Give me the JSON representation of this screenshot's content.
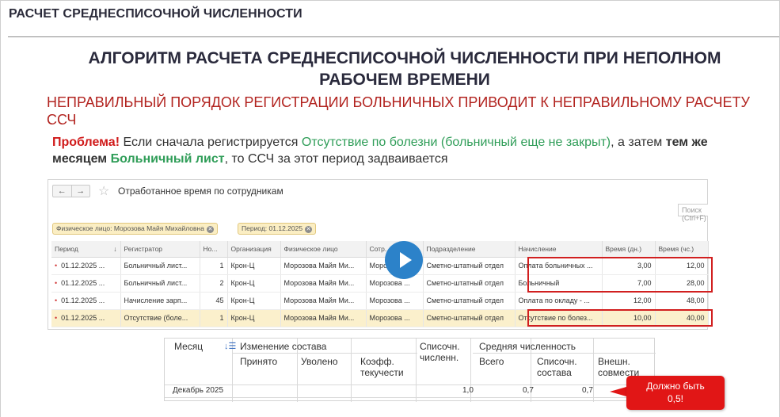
{
  "page": {
    "title": "РАСЧЕТ СРЕДНЕСПИСОЧНОЙ ЧИСЛЕННОСТИ"
  },
  "slide": {
    "heading_line1": "АЛГОРИТМ РАСЧЕТА СРЕДНЕСПИСОЧНОЙ ЧИСЛЕННОСТИ ПРИ НЕПОЛНОМ",
    "heading_line2": "РАБОЧЕМ ВРЕМЕНИ",
    "subtitle": "НЕПРАВИЛЬНЫЙ ПОРЯДОК РЕГИСТРАЦИИ БОЛЬНИЧНЫХ ПРИВОДИТ К НЕПРАВИЛЬНОМУ РАСЧЕТУ ССЧ",
    "problem": {
      "label": "Проблема!",
      "t1": " Если сначала регистрируется ",
      "g1": "Отсутствие по болезни (больничный еще не закрыт)",
      "t2": ", а затем ",
      "b1": "тем же месяцем",
      "t3": " ",
      "g2": "Больничный лист",
      "t4": ", то ССЧ за этот период задваивается"
    },
    "bottom_fragment": "— —— —— — —— — —— —"
  },
  "window": {
    "back": "←",
    "forward": "→",
    "star": "☆",
    "title": "Отработанное время по сотрудникам",
    "search_placeholder": "Поиск (Ctrl+F)",
    "chips": [
      {
        "text": "Физическое лицо: Морозова Майя Михайловна"
      },
      {
        "text": "Период: 01.12.2025"
      }
    ],
    "columns": [
      "Период",
      "Регистратор",
      "Но...",
      "Организация",
      "Физическое лицо",
      "Сотр...",
      "Подразделение",
      "Начисление",
      "Время (дн.)",
      "Время (чс.)"
    ],
    "sort_indicator": "↓",
    "rows": [
      [
        "01.12.2025 ...",
        "Больничный лист...",
        "1",
        "Крон-Ц",
        "Морозова Майя Ми...",
        "Морозова ...",
        "Сметно-штатный отдел",
        "Оплата больничных ...",
        "3,00",
        "12,00"
      ],
      [
        "01.12.2025 ...",
        "Больничный лист...",
        "2",
        "Крон-Ц",
        "Морозова Майя Ми...",
        "Морозова ...",
        "Сметно-штатный отдел",
        "Больничный",
        "7,00",
        "28,00"
      ],
      [
        "01.12.2025 ...",
        "Начисление зарп...",
        "45",
        "Крон-Ц",
        "Морозова Майя Ми...",
        "Морозова ...",
        "Сметно-штатный отдел",
        "Оплата по окладу - ...",
        "12,00",
        "48,00"
      ],
      [
        "01.12.2025 ...",
        "Отсутствие (боле...",
        "1",
        "Крон-Ц",
        "Морозова Майя Ми...",
        "Морозова ...",
        "Сметно-штатный отдел",
        "Отсутствие по болез...",
        "10,00",
        "40,00"
      ]
    ],
    "row_marker": "•"
  },
  "report": {
    "month": "Месяц",
    "sort_icon": "↓☰",
    "change": "Изменение состава",
    "hired": "Принято",
    "fired": "Уволено",
    "turnover1": "Коэфф.",
    "turnover2": "текучести",
    "listed1": "Списочн.",
    "listed2": "численн.",
    "avg": "Средняя численность",
    "total": "Всего",
    "avg_listed1": "Списочн.",
    "avg_listed2": "состава",
    "ext1": "Внешн.",
    "ext2": "совмести",
    "row": {
      "month": "Декабрь 2025",
      "listed": "1,0",
      "total": "0,7",
      "avg_listed": "0,7"
    }
  },
  "callout": {
    "line1": "Должно быть",
    "line2": "0,5!"
  },
  "colors": {
    "accent_red": "#d11f1f",
    "green": "#2f9d58",
    "play": "#2c82c9",
    "highlight": "#fbf0cc"
  }
}
